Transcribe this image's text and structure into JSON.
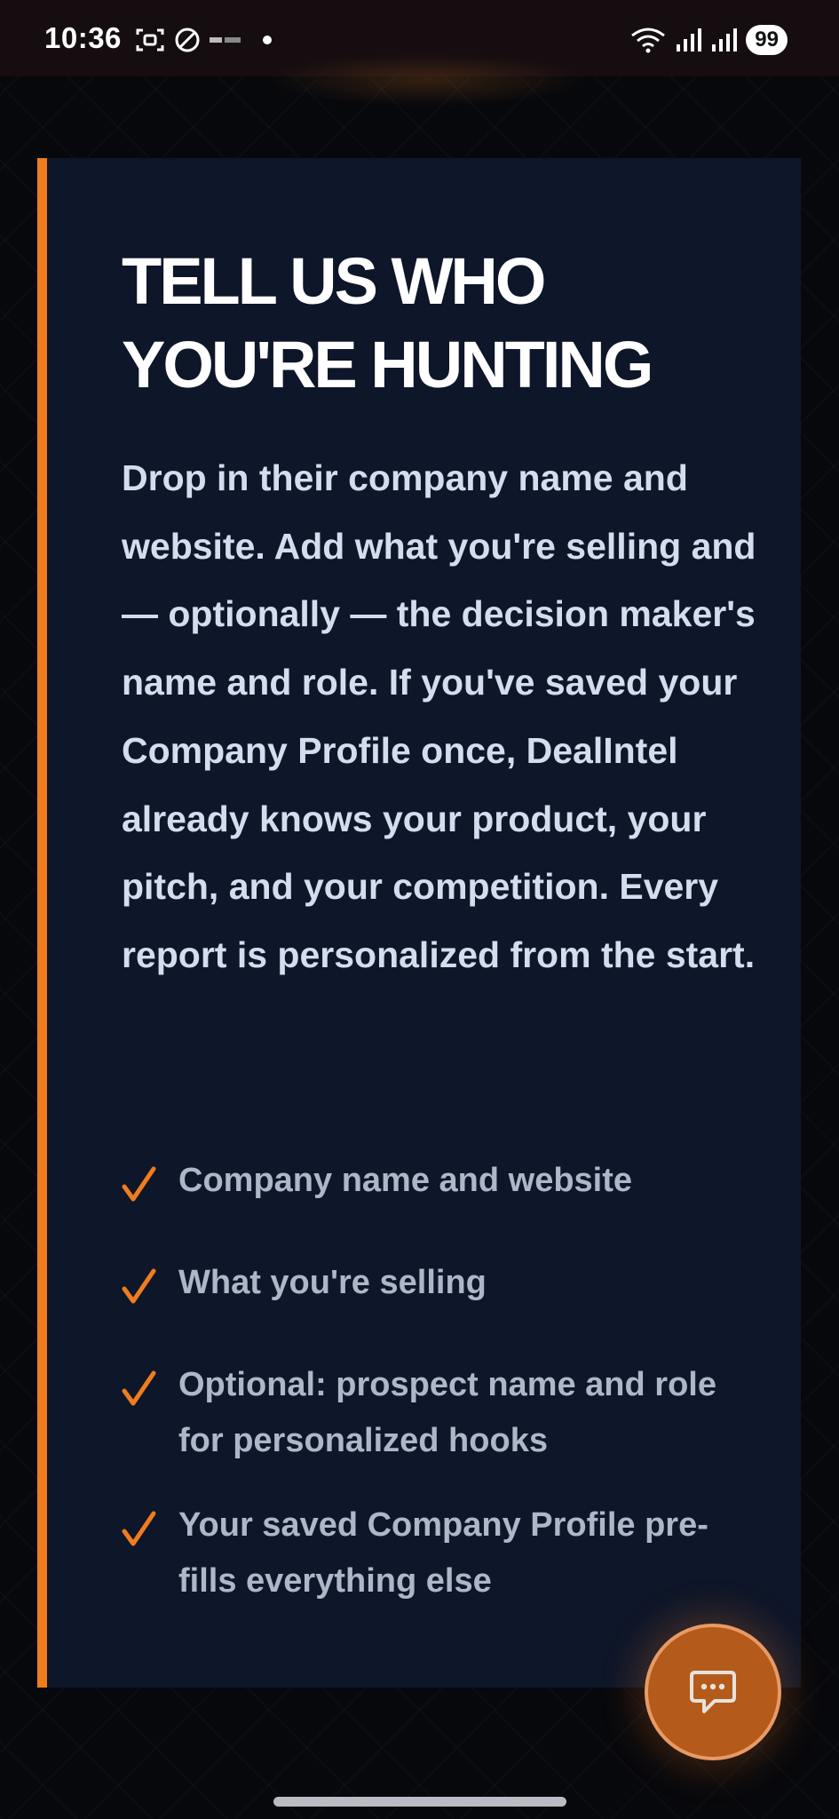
{
  "status_bar": {
    "time": "10:36",
    "battery": "99"
  },
  "section": {
    "title_line1": "TELL US WHO",
    "title_line2": "YOU'RE HUNTING",
    "description": "Drop in their company name and website. Add what you're selling and — optionally — the decision maker's name and role. If you've saved your Company Profile once, DealIntel already knows your product, your pitch, and your competition. Every report is personalized from the start.",
    "checklist": [
      {
        "text": "Company name and website"
      },
      {
        "text": "What you're selling"
      },
      {
        "text": "Optional: prospect name and role for personalized hooks"
      },
      {
        "text": "Your saved Company Profile pre-fills everything else"
      }
    ]
  },
  "colors": {
    "accent": "#f07c1e",
    "card_background": "#0e1629",
    "page_background": "#07080c"
  },
  "icons": {
    "checklist_marker": "checkmark-icon",
    "fab": "chat-bubble-icon"
  }
}
